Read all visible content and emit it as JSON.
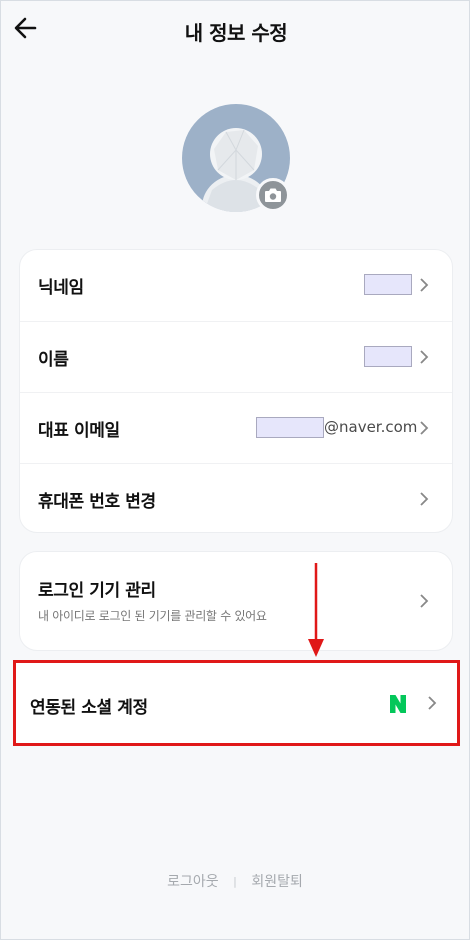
{
  "header": {
    "title": "내 정보 수정"
  },
  "profile_rows": [
    {
      "label": "닉네임"
    },
    {
      "label": "이름"
    },
    {
      "label": "대표 이메일",
      "email_domain": "@naver.com"
    },
    {
      "label": "휴대폰 번호 변경"
    }
  ],
  "device": {
    "label": "로그인 기기 관리",
    "description": "내 아이디로 로그인 된 기기를 관리할 수 있어요"
  },
  "social": {
    "label": "연동된 소셜 계정",
    "provider_icon": "naver-n-icon",
    "provider_color": "#03c75a"
  },
  "footer": {
    "logout": "로그아웃",
    "separator": "|",
    "withdraw": "회원탈퇴"
  },
  "colors": {
    "highlight": "#e01818",
    "mask_fill": "#e6e6fb"
  }
}
